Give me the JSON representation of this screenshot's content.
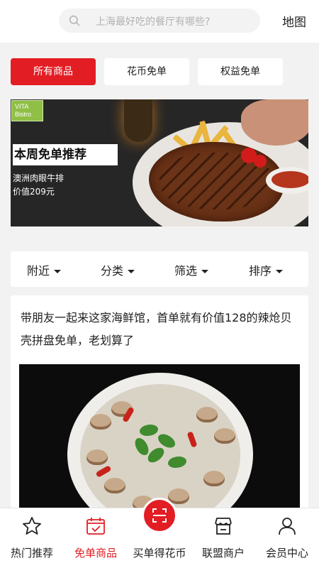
{
  "search": {
    "placeholder": "上海最好吃的餐厅有哪些?"
  },
  "header": {
    "map_label": "地图"
  },
  "tabs": [
    {
      "label": "所有商品",
      "active": true
    },
    {
      "label": "花币免单",
      "active": false
    },
    {
      "label": "权益免单",
      "active": false
    }
  ],
  "banner": {
    "logo_text": "VITA Bistro",
    "title": "本周免单推荐",
    "dish": "澳洲肉眼牛排",
    "price": "价值209元"
  },
  "filters": [
    {
      "label": "附近"
    },
    {
      "label": "分类"
    },
    {
      "label": "筛选"
    },
    {
      "label": "排序"
    }
  ],
  "article": {
    "text": "带朋友一起来这家海鲜馆，首单就有价值128的辣炝贝壳拼盘免单，老划算了"
  },
  "bottom_nav": [
    {
      "label": "热门推荐",
      "icon": "star-icon",
      "active": false
    },
    {
      "label": "免单商品",
      "icon": "free-order-icon",
      "active": true
    },
    {
      "label": "买单得花币",
      "icon": "scan-icon",
      "active": false
    },
    {
      "label": "联盟商户",
      "icon": "store-icon",
      "active": false
    },
    {
      "label": "会员中心",
      "icon": "user-icon",
      "active": false
    }
  ],
  "colors": {
    "accent": "#e31d24",
    "logo_green": "#8fbf45"
  }
}
